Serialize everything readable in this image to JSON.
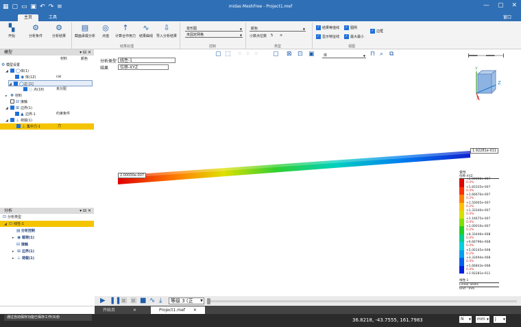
{
  "titlebar": {
    "title": "midas MeshFree - Project1.mef"
  },
  "tabs": {
    "home": "主页",
    "tools": "工具",
    "right": "窗口"
  },
  "ribbon": {
    "buttons": [
      {
        "label": "开始",
        "icon": "start-icon"
      },
      {
        "label": "分析条件",
        "icon": "analysis-condition-icon"
      },
      {
        "label": "分析结果",
        "icon": "analysis-result-icon"
      },
      {
        "label": "截面承载分析",
        "icon": "section-icon"
      },
      {
        "label": "点值",
        "icon": "point-value-icon"
      },
      {
        "label": "计算合作用力",
        "icon": "force-icon"
      },
      {
        "label": "结果曲线",
        "icon": "curve-icon"
      },
      {
        "label": "导入分析结果",
        "icon": "import-icon"
      }
    ],
    "group_result": "结果处理",
    "group_control": "控制",
    "group_type": "类型",
    "group_view": "视图",
    "contour_type": "变形图",
    "contour_style": "未固定网格",
    "contour_color": "颜色",
    "decimal_label": "小数点位数",
    "decimal_value": "5",
    "checks": [
      {
        "label": "结果等值线"
      },
      {
        "label": "图例"
      },
      {
        "label": "显示特征线"
      },
      {
        "label": "最大最小"
      },
      {
        "label": "边框"
      }
    ]
  },
  "model_panel": {
    "title": "模型",
    "col_material": "材料",
    "col_color": "颜色",
    "items": [
      {
        "label": "模型设置",
        "indent": 0
      },
      {
        "label": "体(1)",
        "indent": 1
      },
      {
        "label": "体(1Z)",
        "indent": 2,
        "extra": "cal"
      },
      {
        "label": "边 [1]",
        "indent": 2
      },
      {
        "label": "点(18)",
        "indent": 3,
        "extra": "未分配"
      },
      {
        "label": "材料",
        "indent": 1
      },
      {
        "label": "接触",
        "indent": 1
      },
      {
        "label": "边界(1)",
        "indent": 1
      },
      {
        "label": "边界-1",
        "indent": 2,
        "extra": "约束条件"
      },
      {
        "label": "荷载(1)",
        "indent": 1
      },
      {
        "label": "集中力-1",
        "indent": 2,
        "extra": "力"
      }
    ]
  },
  "analysis_panel": {
    "title": "分析",
    "items": [
      {
        "label": "分析类型",
        "indent": 0
      },
      {
        "label": "线性-1",
        "indent": 1
      },
      {
        "label": "分析控制",
        "indent": 2
      },
      {
        "label": "载荷(1)",
        "indent": 2
      },
      {
        "label": "接触",
        "indent": 2
      },
      {
        "label": "边界(1)",
        "indent": 2
      },
      {
        "label": "荷载(1)",
        "indent": 2
      }
    ]
  },
  "viewport": {
    "analysis_type_label": "分析类型",
    "analysis_type_value": "线性-1",
    "result_label": "结果",
    "result_value": "位移-XYZ",
    "view_combo": "体",
    "min_tag": "2.00000e-007",
    "max_tag": "1.92281e-011"
  },
  "legend": {
    "title": "变形",
    "subtitle": "位移-XYZ",
    "values": [
      "+2.00000e-007",
      "+1.83335e-007",
      "+1.66670e-007",
      "+1.50005e-007",
      "+1.33340e-007",
      "+1.16675e-007",
      "+1.00010e-007",
      "+8.33446e-008",
      "+6.66796e-008",
      "+5.00145e-008",
      "+3.33494e-008",
      "+1.66843e-008",
      "+1.92281e-011"
    ],
    "percents": [
      "0.4%",
      "0.4%",
      "0.2%",
      "0.2%",
      "0.4%",
      "0.4%",
      "0.2%",
      "0.4%",
      "0.4%",
      "0.2%",
      "0.4%",
      "0.4%"
    ],
    "colors": [
      "#e00000",
      "#ff3000",
      "#ff8000",
      "#ffc000",
      "#d8e000",
      "#80e000",
      "#20d020",
      "#00d090",
      "#00d0e0",
      "#00a0f0",
      "#0060f0",
      "#0020e0"
    ],
    "footer1": "线性-1",
    "footer2": "Linear Static",
    "footer3": "Unit : mm"
  },
  "bottombar": {
    "level_label": "等级 3 (正"
  },
  "doctabs": {
    "start_page": "开始页",
    "project": "Project1.mef"
  },
  "status": {
    "message": "通过自动保存功能已保存工作(9)份",
    "coords": "36.8218,  -43.7555,  161.7983",
    "unit_force": "N",
    "unit_length": "mm",
    "unit_energy": "J"
  },
  "axes": {
    "x": "X",
    "y": "Y",
    "z": "Z"
  }
}
